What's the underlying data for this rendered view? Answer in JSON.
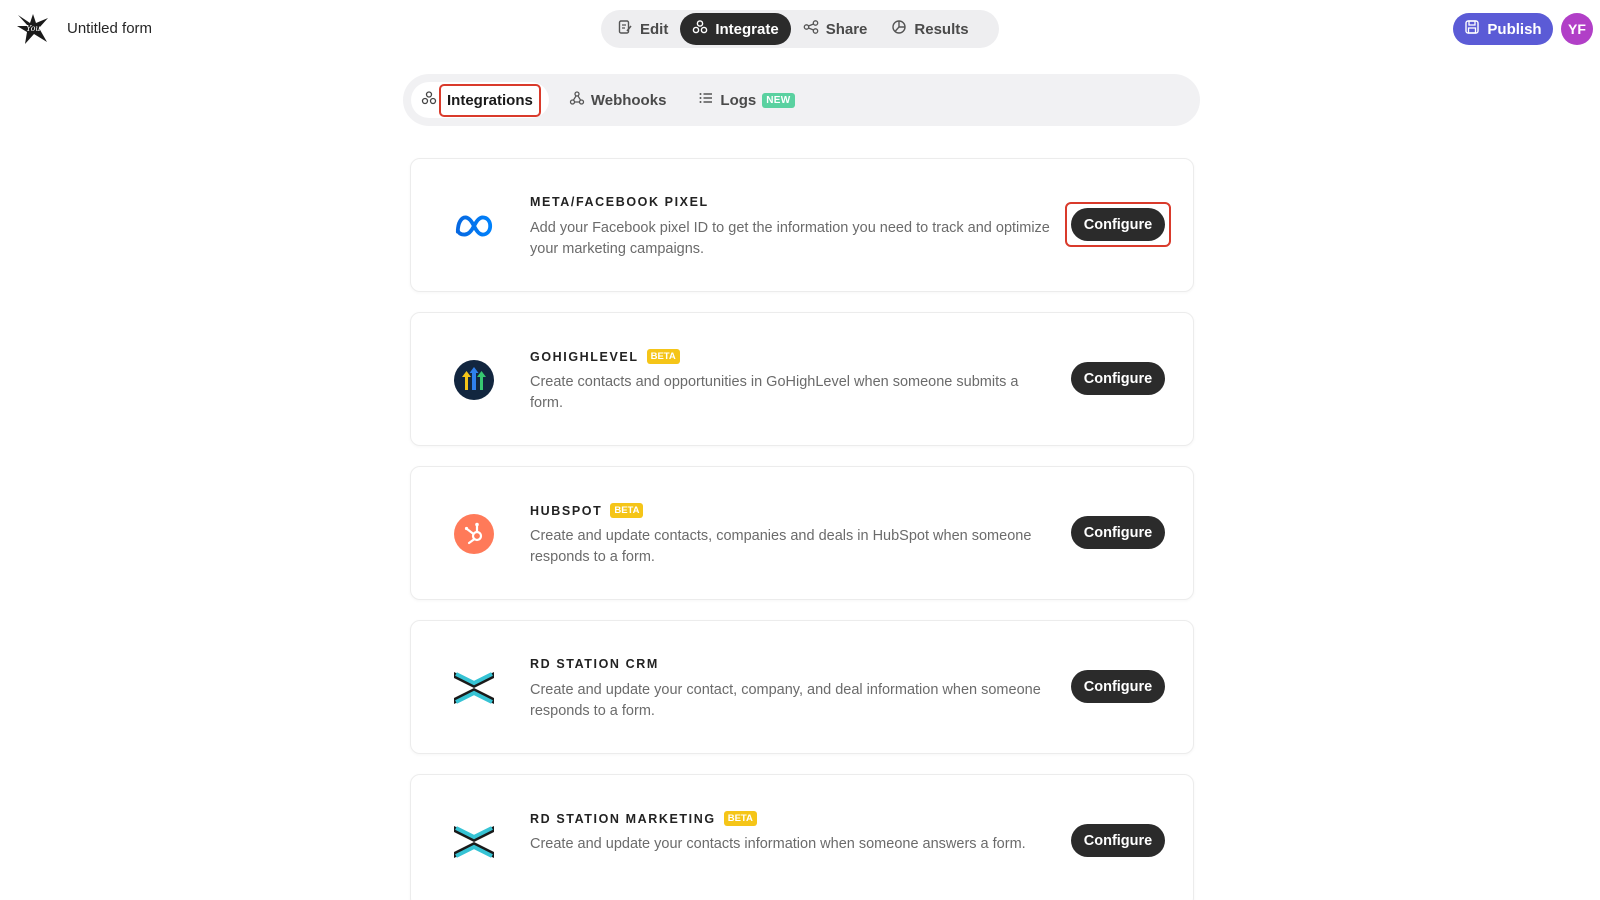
{
  "header": {
    "form_title": "Untitled form",
    "tabs": [
      {
        "label": "Edit",
        "icon": "edit-icon"
      },
      {
        "label": "Integrate",
        "icon": "integrate-icon"
      },
      {
        "label": "Share",
        "icon": "share-icon"
      },
      {
        "label": "Results",
        "icon": "results-icon"
      }
    ],
    "active_tab": "Integrate",
    "publish_label": "Publish",
    "avatar_initials": "YF",
    "accent_color": "#5b5bd6",
    "avatar_color": "#b13fc7"
  },
  "sub_tabs": {
    "items": [
      {
        "label": "Integrations",
        "icon": "integrations-icon"
      },
      {
        "label": "Webhooks",
        "icon": "webhooks-icon"
      },
      {
        "label": "Logs",
        "icon": "list-icon",
        "badge": "NEW"
      }
    ],
    "active": "Integrations"
  },
  "integrations": [
    {
      "title": "META/FACEBOOK PIXEL",
      "badge": "",
      "icon": "meta-icon",
      "description": "Add your Facebook pixel ID to get the information you need to track and optimize your marketing campaigns.",
      "button": "Configure"
    },
    {
      "title": "GOHIGHLEVEL",
      "badge": "BETA",
      "icon": "gohighlevel-icon",
      "description": "Create contacts and opportunities in GoHighLevel when someone submits a form.",
      "button": "Configure"
    },
    {
      "title": "HUBSPOT",
      "badge": "BETA",
      "icon": "hubspot-icon",
      "description": "Create and update contacts, companies and deals in HubSpot when someone responds to a form.",
      "button": "Configure"
    },
    {
      "title": "RD STATION CRM",
      "badge": "",
      "icon": "rd-station-icon",
      "description": "Create and update your contact, company, and deal information when someone responds to a form.",
      "button": "Configure"
    },
    {
      "title": "RD STATION MARKETING",
      "badge": "BETA",
      "icon": "rd-station-icon",
      "description": "Create and update your contacts information when someone answers a form.",
      "button": "Configure"
    }
  ],
  "colors": {
    "highlight": "#d93a2b",
    "beta_badge": "#f5c518",
    "new_badge": "#5ad1a0",
    "button_dark": "#2b2b2b"
  }
}
